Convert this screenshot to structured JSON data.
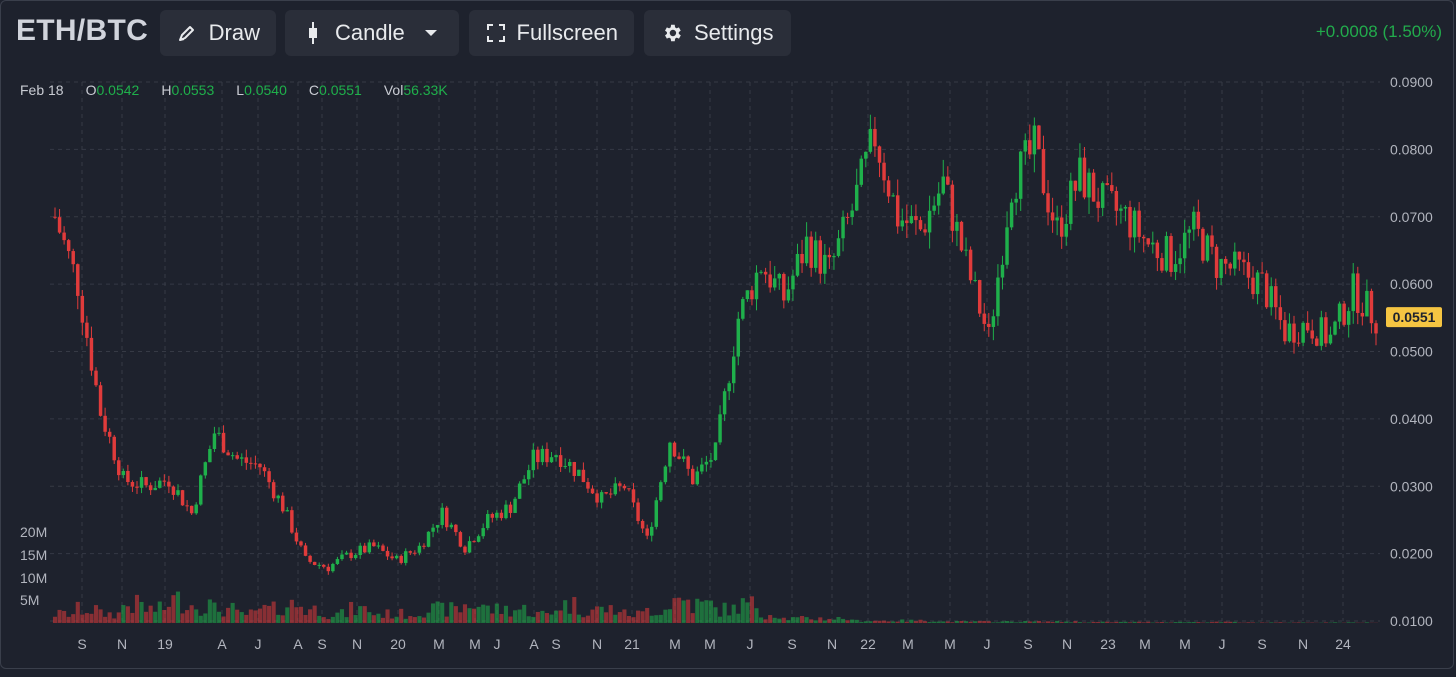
{
  "header": {
    "symbol": "ETH/BTC",
    "draw_label": "Draw",
    "candle_label": "Candle",
    "fullscreen_label": "Fullscreen",
    "settings_label": "Settings",
    "change": "+0.0008 (1.50%)"
  },
  "legend": {
    "date": "Feb 18",
    "o_key": "O",
    "o_val": "0.0542",
    "h_key": "H",
    "h_val": "0.0553",
    "l_key": "L",
    "l_val": "0.0540",
    "c_key": "C",
    "c_val": "0.0551",
    "vol_key": "Vol",
    "vol_val": "56.33K"
  },
  "colors": {
    "up": "#1fb04b",
    "down": "#e03b3b",
    "last_badge": "#f5c542",
    "grid": "#363a45"
  },
  "chart_data": {
    "type": "candlestick",
    "title": "",
    "price_axis": {
      "ticks": [
        "0.0900",
        "0.0800",
        "0.0700",
        "0.0600",
        "0.0500",
        "0.0400",
        "0.0300",
        "0.0200",
        "0.0100"
      ],
      "range": [
        0.01,
        0.09
      ],
      "side": "right"
    },
    "volume_axis": {
      "ticks": [
        "20M",
        "15M",
        "10M",
        "5M"
      ]
    },
    "time_axis": {
      "labels": [
        "S",
        "N",
        "19",
        "A",
        "J",
        "A",
        "S",
        "N",
        "20",
        "M",
        "M",
        "J",
        "A",
        "S",
        "N",
        "21",
        "M",
        "M",
        "J",
        "S",
        "N",
        "22",
        "M",
        "M",
        "J",
        "S",
        "N",
        "23",
        "M",
        "M",
        "J",
        "S",
        "N",
        "24"
      ]
    },
    "last_price": "0.0551",
    "series_close_monthly": [
      0.07,
      0.06,
      0.041,
      0.031,
      0.03,
      0.031,
      0.026,
      0.038,
      0.034,
      0.033,
      0.027,
      0.019,
      0.018,
      0.02,
      0.021,
      0.019,
      0.021,
      0.026,
      0.021,
      0.025,
      0.027,
      0.034,
      0.035,
      0.032,
      0.028,
      0.03,
      0.022,
      0.037,
      0.031,
      0.035,
      0.055,
      0.063,
      0.058,
      0.066,
      0.062,
      0.071,
      0.082,
      0.07,
      0.068,
      0.075,
      0.063,
      0.052,
      0.075,
      0.08,
      0.068,
      0.076,
      0.072,
      0.07,
      0.066,
      0.064,
      0.068,
      0.063,
      0.062,
      0.06,
      0.053,
      0.054,
      0.052,
      0.059,
      0.055
    ],
    "series_volume_monthly_M": [
      2,
      3,
      2,
      4,
      3,
      5,
      4,
      3,
      2,
      3,
      4,
      3,
      2,
      3,
      2,
      2,
      3,
      3,
      4,
      3,
      3,
      2,
      4,
      3,
      3,
      2,
      3,
      5,
      4,
      3,
      4,
      2,
      1,
      1,
      1,
      0.5,
      0.5,
      0.5,
      0.5,
      0.3,
      0.3,
      0.3,
      0.3,
      0.3,
      0.3,
      0.2,
      0.2,
      0.2,
      0.2,
      0.2,
      0.2,
      0.2,
      0.1,
      0.1,
      0.1,
      0.1,
      0.1,
      0.1,
      0.1
    ]
  }
}
